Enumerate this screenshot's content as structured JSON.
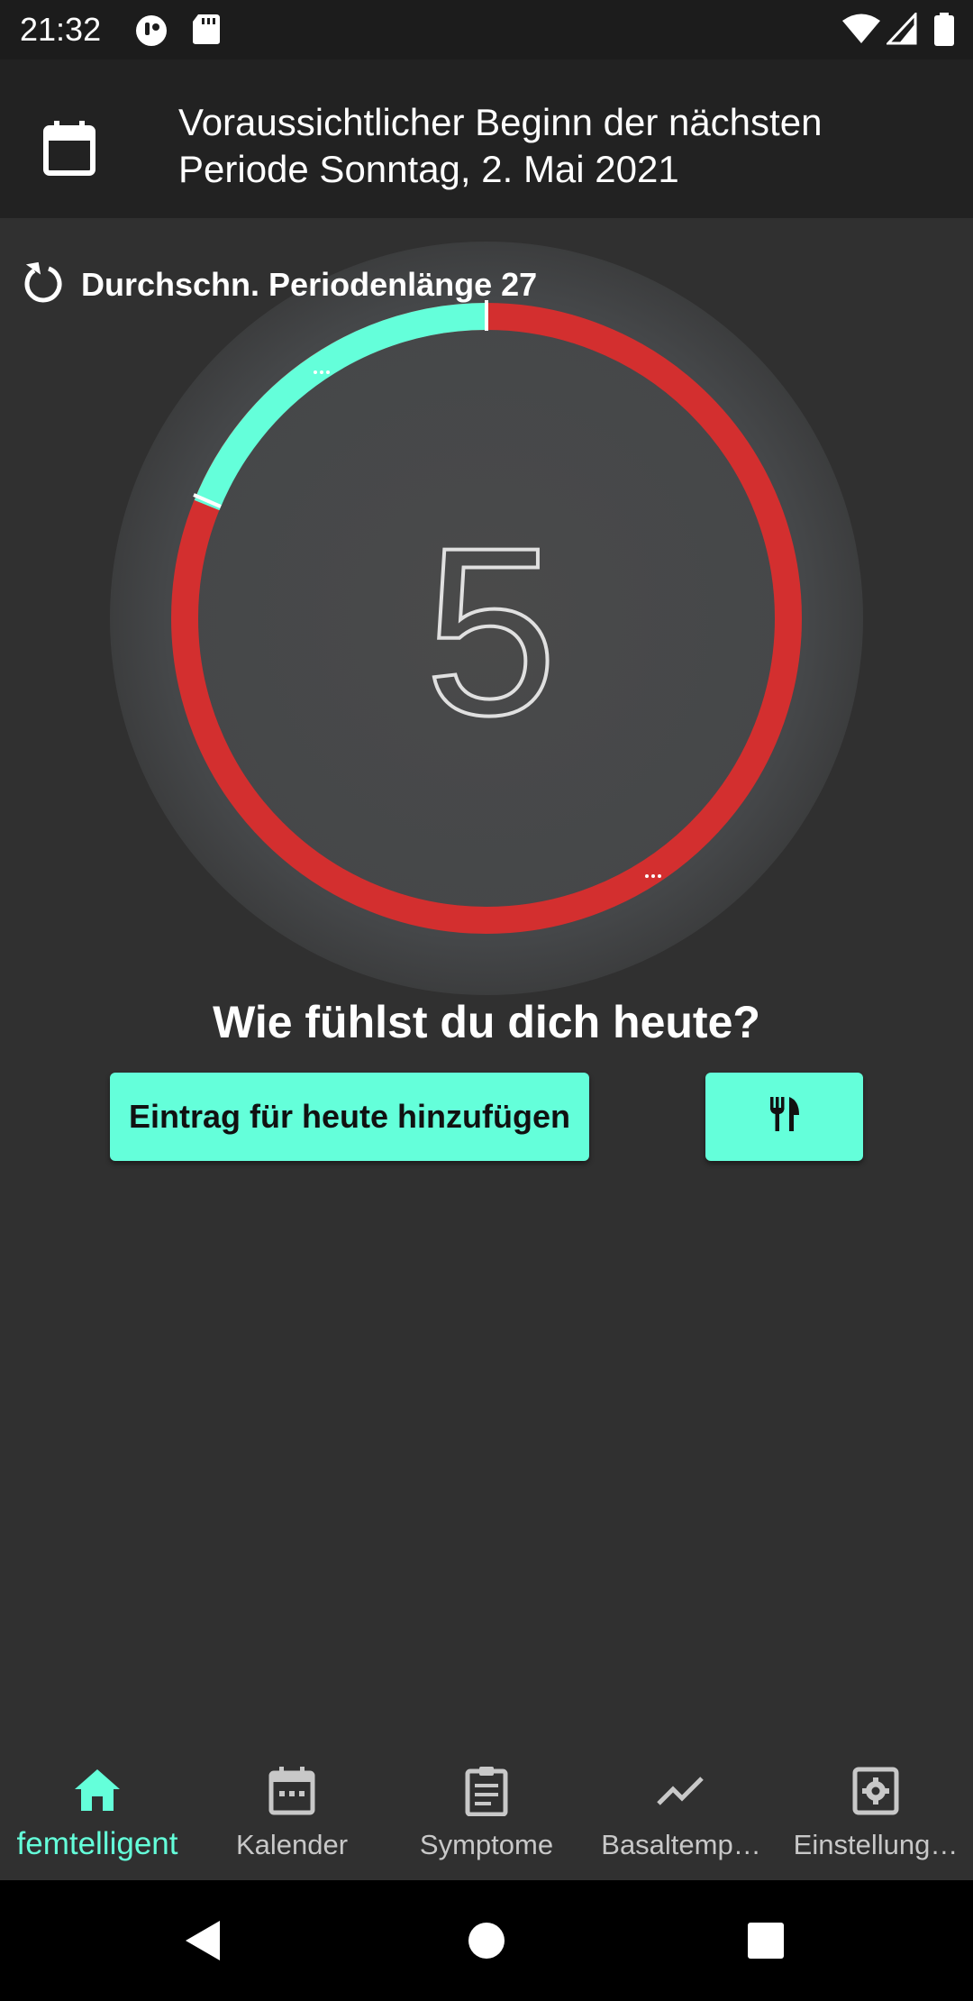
{
  "status_bar": {
    "time": "21:32",
    "icons": [
      "app-notification-icon",
      "sd-card-icon",
      "wifi-icon",
      "signal-icon",
      "battery-icon"
    ]
  },
  "header": {
    "icon": "calendar-icon",
    "title": "Voraussichtlicher Beginn der nächsten Periode Sonntag, 2. Mai 2021"
  },
  "cycle": {
    "average_label": "Durchschn. Periodenlänge 27",
    "day_number": "5",
    "ring_colors": {
      "fertile": "#64ffda",
      "period": "#d32f2f"
    }
  },
  "prompt": {
    "question": "Wie fühlst du dich heute?",
    "add_entry_label": "Eintrag für heute hinzufügen",
    "food_icon": "fork-knife-icon"
  },
  "bottom_nav": {
    "items": [
      {
        "label": "femtelligent",
        "icon": "home-icon",
        "active": true
      },
      {
        "label": "Kalender",
        "icon": "calendar-icon",
        "active": false
      },
      {
        "label": "Symptome",
        "icon": "clipboard-icon",
        "active": false
      },
      {
        "label": "Basaltemp…",
        "icon": "trend-line-icon",
        "active": false
      },
      {
        "label": "Einstellung…",
        "icon": "settings-icon",
        "active": false
      }
    ]
  },
  "colors": {
    "accent": "#64ffda",
    "period_red": "#d32f2f",
    "background": "#303030"
  }
}
